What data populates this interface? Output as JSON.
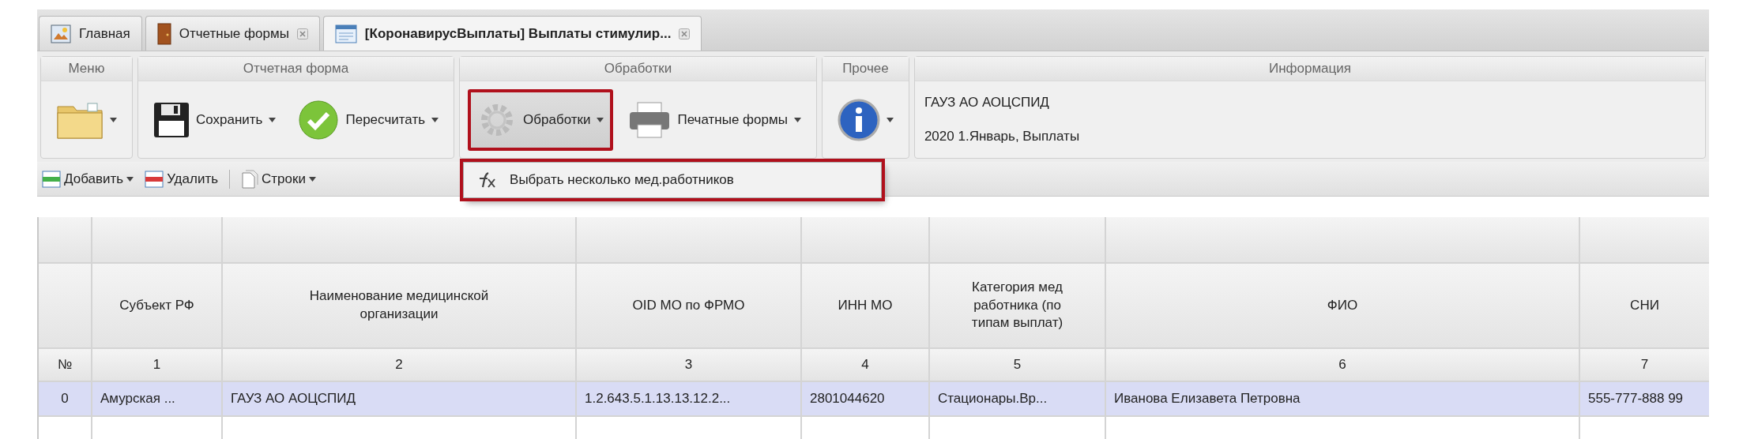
{
  "tabs": [
    {
      "kind": "home",
      "label": "Главная",
      "selected": false,
      "closable": false
    },
    {
      "kind": "door",
      "label": "Отчетные формы",
      "selected": false,
      "closable": true
    },
    {
      "kind": "form",
      "label": "[КоронавирусВыплаты] Выплаты стимулир...",
      "selected": true,
      "closable": true
    }
  ],
  "toolbar": {
    "groups": [
      {
        "title": "Меню",
        "buttons": [
          {
            "kind": "folder",
            "dropdown": true,
            "pressed": false,
            "highlighted": false
          }
        ]
      },
      {
        "title": "Отчетная форма",
        "buttons": [
          {
            "kind": "save",
            "label": "Сохранить",
            "dropdown": true,
            "pressed": false,
            "highlighted": false
          },
          {
            "kind": "check",
            "label": "Пересчитать",
            "dropdown": true,
            "pressed": false,
            "highlighted": false
          }
        ]
      },
      {
        "title": "Обработки",
        "buttons": [
          {
            "kind": "gear",
            "label": "Обработки",
            "dropdown": true,
            "pressed": true,
            "highlighted": true
          },
          {
            "kind": "printer",
            "label": "Печатные формы",
            "dropdown": true,
            "pressed": false,
            "highlighted": false
          }
        ]
      },
      {
        "title": "Прочее",
        "buttons": [
          {
            "kind": "info",
            "dropdown": true,
            "pressed": false,
            "highlighted": false
          }
        ]
      }
    ],
    "info": {
      "title": "Информация",
      "lines": [
        "ГАУЗ АО АОЦСПИД",
        "2020 1.Январь, Выплаты"
      ]
    }
  },
  "menu": {
    "highlighted": true,
    "items": [
      {
        "label": "Выбрать несколько мед.работников"
      }
    ]
  },
  "subtoolbar": [
    {
      "kind": "add",
      "label": "Добавить",
      "dropdown": true
    },
    {
      "kind": "delete",
      "label": "Удалить",
      "dropdown": false
    },
    {
      "kind": "separator"
    },
    {
      "kind": "rows",
      "label": "Строки",
      "dropdown": true
    }
  ],
  "grid": {
    "columns": [
      {
        "number": "№"
      },
      {
        "title": "Субъект РФ",
        "number": "1"
      },
      {
        "title": "Наименование медицинской организации",
        "number": "2"
      },
      {
        "title": "OID МО по ФРМО",
        "number": "3"
      },
      {
        "title": "ИНН МО",
        "number": "4"
      },
      {
        "title": "Категория мед работника (по типам выплат)",
        "number": "5"
      },
      {
        "title": "ФИО",
        "number": "6"
      },
      {
        "title": "СНИ",
        "number": "7"
      }
    ],
    "rows": [
      {
        "selected": true,
        "cells": [
          "0",
          "Амурская ...",
          "ГАУЗ АО АОЦСПИД",
          "1.2.643.5.1.13.13.12.2...",
          "2801044620",
          "Стационары.Вр...",
          "Иванова Елизавета Петровна",
          "555-777-888 99"
        ]
      }
    ]
  }
}
